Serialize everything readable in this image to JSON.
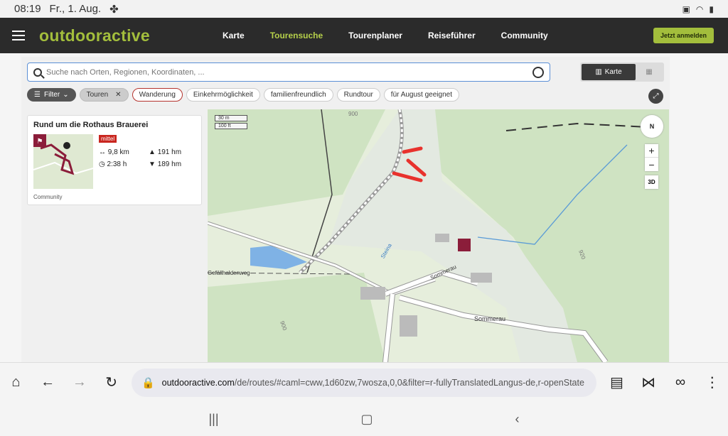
{
  "status": {
    "time": "08:19",
    "date": "Fr., 1. Aug."
  },
  "nav": {
    "logo": "outdooractive",
    "links": [
      "Karte",
      "Tourensuche",
      "Tourenplaner",
      "Reiseführer",
      "Community"
    ],
    "active": "Tourensuche",
    "login": "Jetzt anmelden"
  },
  "search": {
    "placeholder": "Suche nach Orten, Regionen, Koordinaten, ..."
  },
  "view": {
    "map_label": "Karte"
  },
  "filters": {
    "filter_label": "Filter",
    "active_type": "Touren",
    "chips": [
      "Wanderung",
      "Einkehrmöglichkeit",
      "familienfreundlich",
      "Rundtour",
      "für August geeignet"
    ]
  },
  "tour": {
    "title": "Rund um die Rothaus Brauerei",
    "difficulty": "mittel",
    "distance": "9,8 km",
    "ascent": "191 hm",
    "duration": "2:38 h",
    "descent": "189 hm",
    "source": "Community"
  },
  "map": {
    "scale_m": "30 m",
    "scale_ft": "100 ft",
    "compass": "N",
    "zoom_in": "+",
    "zoom_out": "−",
    "btn3d": "3D",
    "labels": {
      "village": "Sommerau",
      "road1": "Sommerau",
      "road2": "Gefällhaldenweg",
      "stream": "Steina",
      "contour1": "900",
      "contour2": "920",
      "contour3": "900"
    }
  },
  "browser": {
    "url_domain": "outdooractive.com",
    "url_path": "/de/routes/#caml=cww,1d60zw,7wosza,0,0&filter=r-fullyTranslatedLangus-de,r-openState"
  }
}
